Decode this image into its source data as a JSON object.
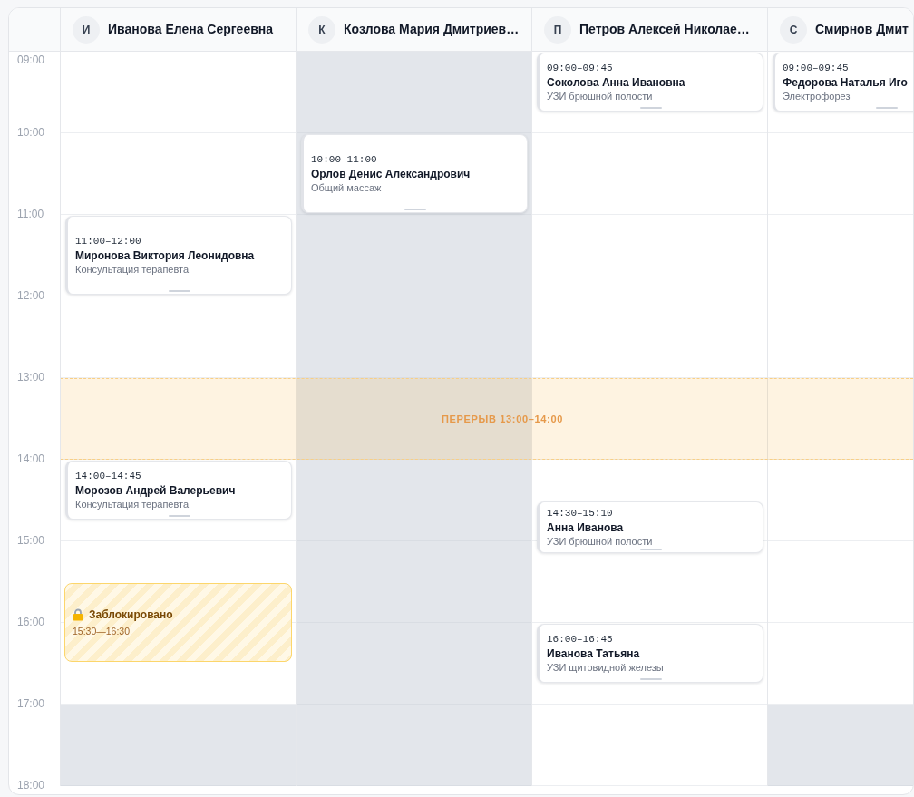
{
  "time_labels": [
    "09:00",
    "10:00",
    "11:00",
    "12:00",
    "13:00",
    "14:00",
    "15:00",
    "16:00",
    "17:00",
    "18:00"
  ],
  "break": {
    "label": "ПЕРЕРЫВ 13:00–14:00"
  },
  "columns": [
    {
      "initial": "И",
      "name": "Иванова Елена Сергеевна",
      "hours": [
        {
          "off": false
        },
        {
          "off": false
        },
        {
          "off": false
        },
        {
          "off": false
        },
        {
          "off": false
        },
        {
          "off": false
        },
        {
          "off": false
        },
        {
          "off": false
        },
        {
          "off": true
        }
      ],
      "events": [
        {
          "kind": "appointment",
          "time": "11:00–12:00",
          "patient": "Миронова Виктория Леонидовна",
          "service": "Консультация терапевта"
        },
        {
          "kind": "appointment",
          "time": "14:00–14:45",
          "patient": "Морозов Андрей Валерьевич",
          "service": "Консультация терапевта"
        },
        {
          "kind": "blocked",
          "title": "Заблокировано",
          "time": "15:30—16:30"
        }
      ]
    },
    {
      "initial": "К",
      "name": "Козлова Мария Дмитриев…",
      "hours": [
        {
          "off": true
        },
        {
          "off": true
        },
        {
          "off": true
        },
        {
          "off": true
        },
        {
          "off": true
        },
        {
          "off": true
        },
        {
          "off": true
        },
        {
          "off": true
        },
        {
          "off": true
        }
      ],
      "events": [
        {
          "kind": "appointment",
          "time": "10:00–11:00",
          "patient": "Орлов Денис Александрович",
          "service": "Общий массаж"
        }
      ]
    },
    {
      "initial": "П",
      "name": "Петров Алексей Николае…",
      "hours": [
        {
          "off": false
        },
        {
          "off": false
        },
        {
          "off": false
        },
        {
          "off": false
        },
        {
          "off": false
        },
        {
          "off": false
        },
        {
          "off": false
        },
        {
          "off": false
        },
        {
          "off": false
        }
      ],
      "events": [
        {
          "kind": "appointment",
          "time": "09:00–09:45",
          "patient": "Соколова Анна Ивановна",
          "service": "УЗИ брюшной полости"
        },
        {
          "kind": "appointment",
          "time": "14:30–15:10",
          "patient": "Анна Иванова",
          "service": "УЗИ брюшной полости"
        },
        {
          "kind": "appointment",
          "time": "16:00–16:45",
          "patient": "Иванова Татьяна",
          "service": "УЗИ щитовидной железы"
        }
      ]
    },
    {
      "initial": "С",
      "name": "Смирнов Дмит",
      "hours": [
        {
          "off": false
        },
        {
          "off": false
        },
        {
          "off": false
        },
        {
          "off": false
        },
        {
          "off": false
        },
        {
          "off": false
        },
        {
          "off": false
        },
        {
          "off": false
        },
        {
          "off": true
        }
      ],
      "events": [
        {
          "kind": "appointment",
          "time": "09:00–09:45",
          "patient": "Федорова Наталья Иго",
          "service": "Электрофорез"
        }
      ]
    }
  ]
}
